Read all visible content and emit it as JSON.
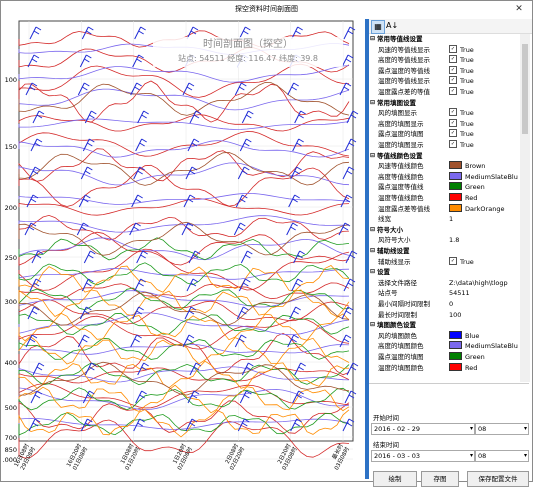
{
  "window": {
    "title": "探空资料时间剖面图",
    "close_symbol": "✕"
  },
  "chart": {
    "title": "时间剖面图（探空）",
    "subtitle": "站点: 54511 经度: 116.47 纬度: 39.8",
    "y_ticks": [
      "100",
      "150",
      "200",
      "250",
      "300",
      "400",
      "500",
      "700",
      "850",
      "1000"
    ],
    "x_ticks": [
      "16日08时\n29日08时",
      "16日20时\n01日08时",
      "1日08时\n01日20时",
      "1日20时\n02日08时",
      "2日08时\n02日20时",
      "2日20时\n03日08时",
      "最长时\n03日08时"
    ],
    "colors": {
      "red": "#d42a2a",
      "purple": "#7b68ee",
      "green": "#1e9b1e",
      "orange": "#ff8c00",
      "brown": "#a0522d"
    }
  },
  "toolbar": {
    "sort_icon": "A↓",
    "category_icon": "▦"
  },
  "property_grid": {
    "categories": [
      {
        "label": "常用等值线设置",
        "props": [
          {
            "label": "风速的等值线显示",
            "value": "True",
            "type": "bool"
          },
          {
            "label": "高度的等值线显示",
            "value": "True",
            "type": "bool"
          },
          {
            "label": "露点温度的等值线",
            "value": "True",
            "type": "bool"
          },
          {
            "label": "温度的等值线显示",
            "value": "True",
            "type": "bool"
          },
          {
            "label": "温度露点差的等值",
            "value": "True",
            "type": "bool"
          }
        ]
      },
      {
        "label": "常用填图设置",
        "props": [
          {
            "label": "风的填图显示",
            "value": "True",
            "type": "bool"
          },
          {
            "label": "高度的填图显示",
            "value": "True",
            "type": "bool"
          },
          {
            "label": "露点温度的填图",
            "value": "True",
            "type": "bool"
          },
          {
            "label": "温度的填图显示",
            "value": "True",
            "type": "bool"
          }
        ]
      },
      {
        "label": "等值线颜色设置",
        "props": [
          {
            "label": "风速等值线颜色",
            "value": "Brown",
            "type": "color",
            "color": "#a0522d"
          },
          {
            "label": "高度等值线颜色",
            "value": "MediumSlateBlu",
            "type": "color",
            "color": "#7b68ee"
          },
          {
            "label": "露点温度等值线",
            "value": "Green",
            "type": "color",
            "color": "#008000"
          },
          {
            "label": "温度等值线颜色",
            "value": "Red",
            "type": "color",
            "color": "#ff0000"
          },
          {
            "label": "温度露点差等值线",
            "value": "DarkOrange",
            "type": "color",
            "color": "#ff8c00"
          },
          {
            "label": "线宽",
            "value": "1",
            "type": "text"
          }
        ]
      },
      {
        "label": "符号大小",
        "props": [
          {
            "label": "风符号大小",
            "value": "1.8",
            "type": "text"
          }
        ]
      },
      {
        "label": "辅助线设置",
        "props": [
          {
            "label": "辅助线显示",
            "value": "True",
            "type": "bool"
          }
        ]
      },
      {
        "label": "设置",
        "props": [
          {
            "label": "选择文件路径",
            "value": "Z:\\data\\high\\tlogp",
            "type": "text"
          },
          {
            "label": "站点号",
            "value": "54511",
            "type": "text"
          },
          {
            "label": "最小间隔时间限制",
            "value": "0",
            "type": "text"
          },
          {
            "label": "最长时间限制",
            "value": "100",
            "type": "text"
          }
        ]
      },
      {
        "label": "填图颜色设置",
        "props": [
          {
            "label": "风的填图颜色",
            "value": "Blue",
            "type": "color",
            "color": "#0000ff"
          },
          {
            "label": "高度的填图颜色",
            "value": "MediumSlateBlu",
            "type": "color",
            "color": "#7b68ee"
          },
          {
            "label": "露点温度的填图",
            "value": "Green",
            "type": "color",
            "color": "#008000"
          },
          {
            "label": "温度的填图颜色",
            "value": "Red",
            "type": "color",
            "color": "#ff0000"
          }
        ]
      }
    ]
  },
  "time": {
    "start_label": "开始时间",
    "end_label": "结束时间",
    "start_date": "2016 - 02 - 29",
    "start_hour": "08",
    "end_date": "2016 - 03 - 03",
    "end_hour": "08"
  },
  "buttons": {
    "draw": "绘制",
    "save_image": "存图",
    "save_config": "保存配置文件"
  }
}
